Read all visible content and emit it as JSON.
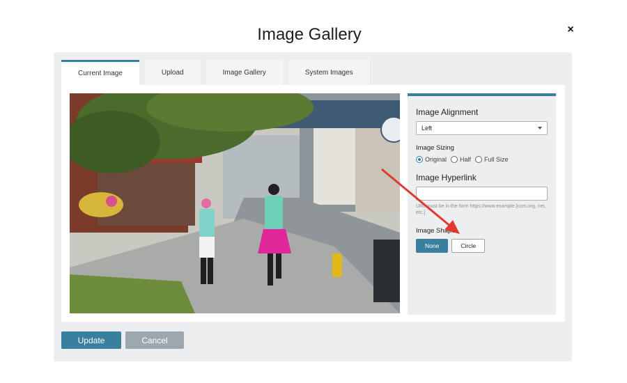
{
  "dialog": {
    "title": "Image Gallery",
    "close_symbol": "×"
  },
  "tabs": [
    {
      "label": "Current Image",
      "active": true
    },
    {
      "label": "Upload",
      "active": false
    },
    {
      "label": "Image Gallery",
      "active": false
    },
    {
      "label": "System Images",
      "active": false
    }
  ],
  "settings": {
    "alignment_label": "Image Alignment",
    "alignment_value": "Left",
    "sizing_label": "Image Sizing",
    "sizing_options": [
      "Original",
      "Half",
      "Full Size"
    ],
    "sizing_selected": "Original",
    "hyperlink_label": "Image Hyperlink",
    "hyperlink_value": "",
    "hyperlink_hint": "URL must be in the form https://www.example.[com,org, net, etc.]",
    "shape_label": "Image Shape",
    "shape_options": [
      "None",
      "Circle"
    ],
    "shape_selected": "None"
  },
  "footer": {
    "update_label": "Update",
    "cancel_label": "Cancel"
  },
  "colors": {
    "accent": "#3a7f9e",
    "annotation_arrow": "#e03a2f"
  },
  "icons": {
    "close": "close-icon",
    "dropdown": "chevron-down-icon"
  }
}
